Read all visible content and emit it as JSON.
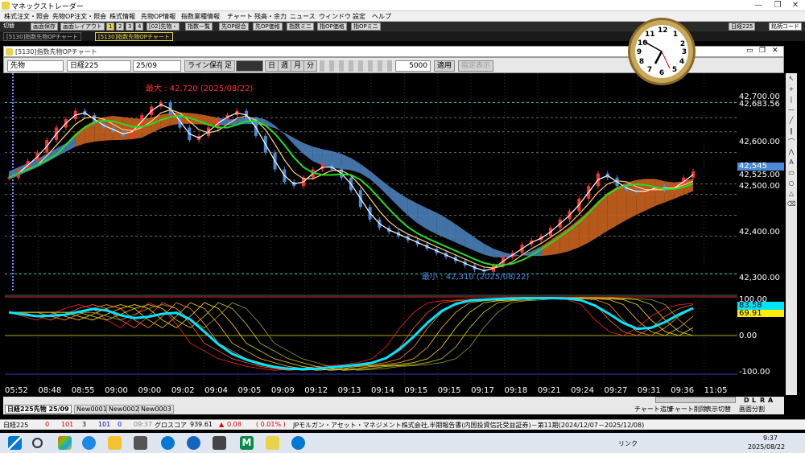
{
  "window": {
    "title": "マネックストレーダー",
    "controls": [
      "—",
      "❐",
      "✕"
    ]
  },
  "menu": [
    "株式注文・照会",
    "先物OP注文・照会",
    "株式情報",
    "先物OP情報",
    "指数業種情報",
    "チャート",
    "残高・余力",
    "ニュース",
    "ウィンドウ",
    "設定",
    "ヘルプ"
  ],
  "toolbar": {
    "items": [
      "切替",
      "画面保存",
      "画面レイアウト",
      "1",
      "2",
      "3",
      "4",
      "[02]先物・",
      "指数一覧",
      "先OP総合",
      "先OP価格",
      "指数ミニ",
      "指OP価格",
      "指OPミニ"
    ],
    "right": "日経225",
    "right2": "銘柄コード"
  },
  "tabs": [
    "[5130]指数先物OPチャート",
    "[5130]指数先物OPチャート"
  ],
  "chart_window": {
    "title": "[5130]指数先物OPチャート"
  },
  "chart_toolbar": {
    "type": "先物",
    "symbol": "日経225",
    "month": "25/09",
    "line_save": "ライン保存",
    "interval": "足",
    "period_buttons": [
      "日",
      "週",
      "月",
      "分"
    ],
    "count": "5000",
    "apply": "適用",
    "hidden": "指定表示"
  },
  "price_labels": {
    "max": "最大 : 42,720 (2025/08/22)",
    "min": "最小 : 42,310 (2025/08/22)"
  },
  "price_axis": [
    "42,700.00",
    "42,683.56",
    "42,600.00",
    "42,525.00",
    "42,500.00",
    "42,400.00",
    "42,300.00"
  ],
  "price_highlight": "42,545",
  "osc_axis": [
    "100.00",
    "0.00",
    "-100.00"
  ],
  "osc_values": [
    "83.58",
    "69.91"
  ],
  "time_labels": [
    "05:52",
    "08:48",
    "08:55",
    "09:00",
    "09:00",
    "09:02",
    "09:04",
    "09:05",
    "09:09",
    "09:12",
    "09:13",
    "09:14",
    "09:15",
    "09:15",
    "09:17",
    "09:18",
    "09:21",
    "09:24",
    "09:27",
    "09:31",
    "09:36",
    "11:05"
  ],
  "chart_tabs": {
    "items": [
      "日経225先物 25/09",
      "New0001",
      "New0002",
      "New0003"
    ],
    "right": [
      "チャート追加",
      "チャート削除",
      "表示切替",
      "画面分割"
    ],
    "ranges": [
      "D",
      "L",
      "R",
      "A"
    ]
  },
  "status": {
    "symbol": "日経225",
    "v1": "0",
    "v2": "101",
    "v3": "3",
    "v4": "101",
    "v5": "0",
    "time": "09:37",
    "name": "グロスコア",
    "price": "939.61",
    "change": "0.08",
    "pct": "( 0.01% )",
    "news": "JPモルガン・アセット・マネジメント株式会社,半期報告書(内国投資信託受益証券)－第11期(2024/12/07－2025/12/08)"
  },
  "clock": {
    "numbers": [
      "12",
      "1",
      "2",
      "3",
      "4",
      "5",
      "6",
      "7",
      "8",
      "9",
      "10",
      "11"
    ]
  },
  "taskbar": {
    "tray": "リンク",
    "time": "9:37",
    "date": "2025/08/22"
  },
  "chart_data": {
    "type": "line",
    "title": "",
    "ylim": [
      42270,
      42790
    ],
    "price": [
      42540,
      42560,
      42580,
      42600,
      42630,
      42660,
      42680,
      42700,
      42690,
      42670,
      42660,
      42650,
      42640,
      42660,
      42690,
      42710,
      42720,
      42690,
      42660,
      42630,
      42640,
      42660,
      42680,
      42690,
      42700,
      42680,
      42640,
      42600,
      42560,
      42530,
      42520,
      42540,
      42560,
      42570,
      42560,
      42540,
      42510,
      42470,
      42440,
      42420,
      42410,
      42400,
      42390,
      42380,
      42370,
      42360,
      42350,
      42340,
      42330,
      42320,
      42315,
      42330,
      42350,
      42360,
      42380,
      42390,
      42400,
      42420,
      42440,
      42460,
      42490,
      42520,
      42550,
      42540,
      42520,
      42510,
      42505,
      42510,
      42520,
      42510,
      42520,
      42540,
      42555
    ],
    "osc": [
      60,
      50,
      40,
      55,
      70,
      80,
      70,
      40,
      20,
      50,
      85,
      70,
      30,
      -20,
      -40,
      -60,
      -70,
      -80,
      -85,
      -90,
      -88,
      -85,
      -80,
      -78,
      -75,
      -70,
      -60,
      -30,
      20,
      60,
      85,
      90,
      92,
      95,
      95,
      96,
      97,
      98,
      97,
      95,
      93,
      80,
      40,
      10,
      0,
      20,
      50,
      70,
      80,
      83
    ]
  }
}
